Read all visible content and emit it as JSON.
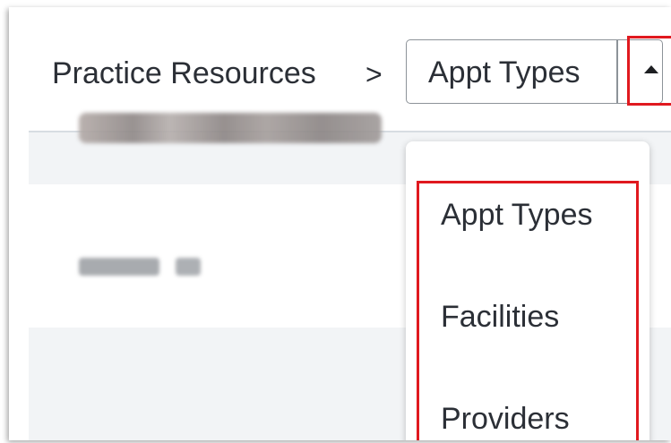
{
  "breadcrumb": {
    "parent": "Practice Resources",
    "separator": ">"
  },
  "select": {
    "value": "Appt Types",
    "toggle_icon": "caret-up-icon"
  },
  "dropdown": {
    "options": [
      "Appt Types",
      "Facilities",
      "Providers"
    ]
  },
  "colors": {
    "highlight": "#e0191f",
    "text": "#2b2f36",
    "border": "#8d9399",
    "row_band": "#f2f4f6"
  }
}
